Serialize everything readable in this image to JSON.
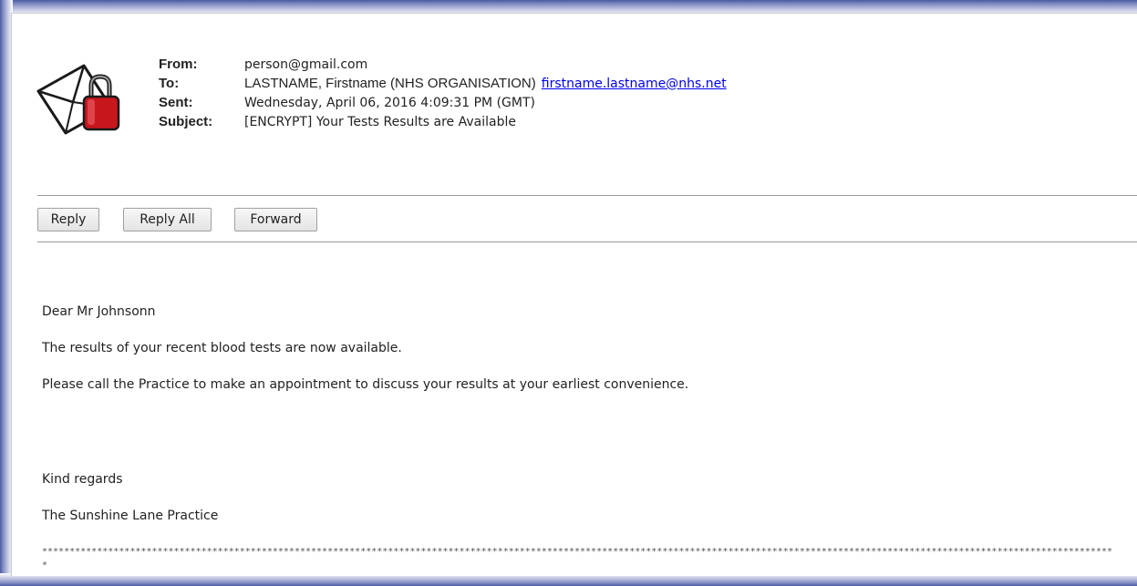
{
  "email": {
    "from_label": "From:",
    "from_value": "person@gmail.com",
    "to_label": "To:",
    "to_value": "LASTNAME, Firstname (NHS ORGANISATION)",
    "to_link": "firstname.lastname@nhs.net",
    "sent_label": "Sent:",
    "sent_value": "Wednesday, April 06, 2016 4:09:31 PM (GMT)",
    "subject_label": "Subject:",
    "subject_value": "[ENCRYPT] Your Tests Results are Available"
  },
  "toolbar": {
    "reply_label": "Reply",
    "reply_all_label": "Reply All",
    "forward_label": "Forward"
  },
  "body": {
    "greeting": "Dear Mr Johnsonn",
    "line1": "The results of your recent blood tests are now available.",
    "line2": "Please call the Practice to make an appointment to discuss your results at your earliest convenience.",
    "closing": "Kind regards",
    "signature": "The Sunshine Lane Practice",
    "separator": "****************************************************************************************************************************************************************************************************"
  },
  "icons": {
    "mail": "encrypted-envelope-icon"
  },
  "colors": {
    "frame_shadow": "#4a5a9e",
    "link": "#0000ee",
    "padlock": "#c8161d"
  }
}
